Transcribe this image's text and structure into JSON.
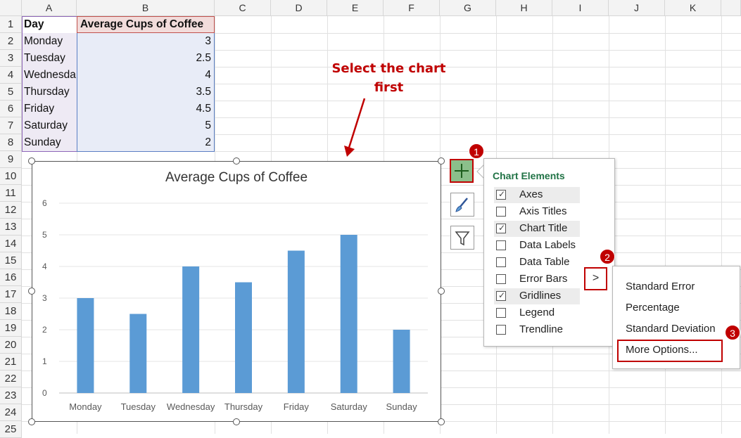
{
  "columns": [
    "A",
    "B",
    "C",
    "D",
    "E",
    "F",
    "G",
    "H",
    "I",
    "J",
    "K"
  ],
  "rows": [
    "1",
    "2",
    "3",
    "4",
    "5",
    "6",
    "7",
    "8",
    "9",
    "10",
    "11",
    "12",
    "13",
    "14",
    "15",
    "16",
    "17",
    "18",
    "19",
    "20",
    "21",
    "22",
    "23",
    "24",
    "25"
  ],
  "table": {
    "headers": [
      "Day",
      "Average Cups of Coffee"
    ],
    "rows": [
      {
        "day": "Monday",
        "value": "3"
      },
      {
        "day": "Tuesday",
        "value": "2.5"
      },
      {
        "day": "Wednesda",
        "value": "4"
      },
      {
        "day": "Thursday",
        "value": "3.5"
      },
      {
        "day": "Friday",
        "value": "4.5"
      },
      {
        "day": "Saturday",
        "value": "5"
      },
      {
        "day": "Sunday",
        "value": "2"
      }
    ]
  },
  "annotation": {
    "line1": "Select the chart",
    "line2": "first"
  },
  "chart_data": {
    "type": "bar",
    "title": "Average Cups of Coffee",
    "categories": [
      "Monday",
      "Tuesday",
      "Wednesday",
      "Thursday",
      "Friday",
      "Saturday",
      "Sunday"
    ],
    "values": [
      3,
      2.5,
      4,
      3.5,
      4.5,
      5,
      2
    ],
    "ylim": [
      0,
      6
    ],
    "yticks": [
      "0",
      "1",
      "2",
      "3",
      "4",
      "5",
      "6"
    ],
    "grid": true,
    "bar_color": "#5b9bd5"
  },
  "side_buttons": [
    {
      "icon": "plus-icon"
    },
    {
      "icon": "paintbrush-icon"
    },
    {
      "icon": "filter-icon"
    }
  ],
  "chart_elements": {
    "title": "Chart Elements",
    "items": [
      {
        "label": "Axes",
        "checked": true
      },
      {
        "label": "Axis Titles",
        "checked": false
      },
      {
        "label": "Chart Title",
        "checked": true
      },
      {
        "label": "Data Labels",
        "checked": false
      },
      {
        "label": "Data Table",
        "checked": false
      },
      {
        "label": "Error Bars",
        "checked": false
      },
      {
        "label": "Gridlines",
        "checked": true
      },
      {
        "label": "Legend",
        "checked": false
      },
      {
        "label": "Trendline",
        "checked": false
      }
    ],
    "expand_glyph": ">"
  },
  "error_bars_menu": {
    "items": [
      "Standard Error",
      "Percentage",
      "Standard Deviation",
      "More Options..."
    ]
  },
  "badges": [
    "1",
    "2",
    "3"
  ],
  "colors": {
    "accent_red": "#c00000",
    "green_title": "#217346"
  }
}
